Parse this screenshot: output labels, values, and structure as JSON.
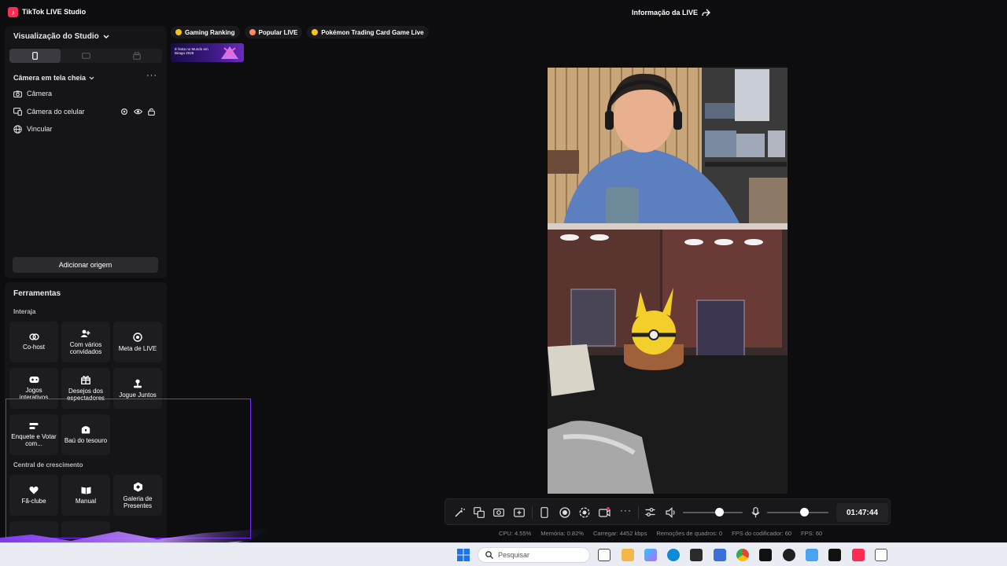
{
  "window": {
    "app_title": "TikTok LIVE Studio",
    "live_info": "Informação da LIVE"
  },
  "studio": {
    "title": "Visualização do Studio",
    "scene": "Câmera em tela cheia",
    "sources": [
      {
        "label": "Câmera",
        "icon": "camera-icon"
      },
      {
        "label": "Câmera do celular",
        "icon": "phone-camera-icon"
      },
      {
        "label": "Vincular",
        "icon": "globe-icon"
      }
    ],
    "add_source": "Adicionar origem"
  },
  "tools": {
    "title": "Ferramentas",
    "interact_label": "Interaja",
    "interact": [
      {
        "label": "Co-host",
        "icon": "link-icon"
      },
      {
        "label": "Com vários convidados",
        "icon": "users-icon"
      },
      {
        "label": "Meta de LIVE",
        "icon": "target-icon"
      },
      {
        "label": "Jogos interativos",
        "icon": "gamepad-icon"
      },
      {
        "label": "Desejos dos espectadores",
        "icon": "gift-icon"
      },
      {
        "label": "Jogue Juntos",
        "icon": "joystick-icon"
      },
      {
        "label": "Enquete e Votar com...",
        "icon": "poll-icon"
      },
      {
        "label": "Baú do tesouro",
        "icon": "chest-icon"
      }
    ],
    "growth_label": "Central de crescimento",
    "growth": [
      {
        "label": "Fã-clube",
        "icon": "heart-icon"
      },
      {
        "label": "Manual",
        "icon": "book-icon"
      },
      {
        "label": "Galeria de Presentes",
        "icon": "gallery-icon"
      }
    ]
  },
  "tabs": [
    {
      "label": "Gaming Ranking",
      "color": "#f5c518"
    },
    {
      "label": "Popular LIVE",
      "color": "#ff8a5c"
    },
    {
      "label": "Pokémon Trading Card Game Live",
      "color": "#f5c518"
    }
  ],
  "banner": {
    "text": "É festa no Mundo em Birago 2026"
  },
  "controls": {
    "timer": "01:47:44",
    "speaker_level": 0.6,
    "mic_level": 0.6
  },
  "stats": [
    {
      "label": "CPU:",
      "value": "4.55%"
    },
    {
      "label": "Memória:",
      "value": "0.82%"
    },
    {
      "label": "Carregar:",
      "value": "4452 kbps"
    },
    {
      "label": "Remoções de quadros:",
      "value": "0"
    },
    {
      "label": "FPS do codificador:",
      "value": "60"
    },
    {
      "label": "FPS:",
      "value": "60"
    }
  ],
  "taskbar": {
    "search_placeholder": "Pesquisar"
  },
  "colors": {
    "accent": "#fe2c55",
    "selection": "#7b2cff",
    "panel": "#151518"
  }
}
